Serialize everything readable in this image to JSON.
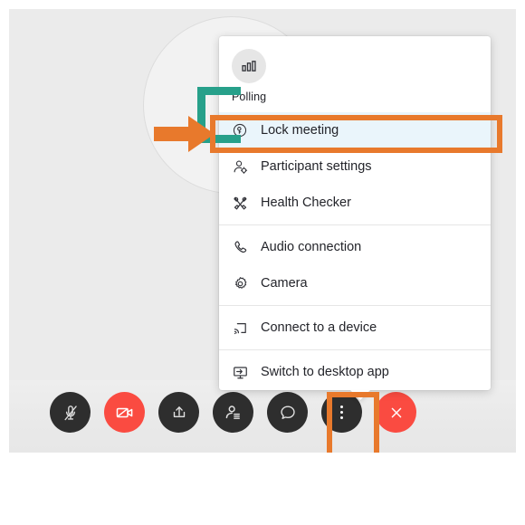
{
  "app": {
    "kind": "video-meeting-controls",
    "accent_orange": "#e8792c",
    "accent_teal": "#27a08a",
    "highlight_blue": "#eaf5fb",
    "button_dark": "#2e2e2e",
    "button_red": "#fa4b41",
    "stage_bg": "#ebebeb"
  },
  "menu": {
    "header": {
      "icon": "polling-bar-chart-icon",
      "label": "Polling"
    },
    "items": [
      {
        "label": "Lock meeting",
        "icon": "lock-key-icon",
        "highlighted": true,
        "divider_after": false
      },
      {
        "label": "Participant settings",
        "icon": "participant-gear-icon",
        "highlighted": false,
        "divider_after": false
      },
      {
        "label": "Health Checker",
        "icon": "health-checker-icon",
        "highlighted": false,
        "divider_after": true
      },
      {
        "label": "Audio connection",
        "icon": "phone-icon",
        "highlighted": false,
        "divider_after": false
      },
      {
        "label": "Camera",
        "icon": "gear-icon",
        "highlighted": false,
        "divider_after": true
      },
      {
        "label": "Connect to a device",
        "icon": "cast-device-icon",
        "highlighted": false,
        "divider_after": true
      },
      {
        "label": "Switch to desktop app",
        "icon": "desktop-monitor-icon",
        "highlighted": false,
        "divider_after": false
      }
    ]
  },
  "controls": [
    {
      "name": "mute-button",
      "icon": "microphone-muted-icon",
      "style": "dark",
      "state": "muted"
    },
    {
      "name": "video-button",
      "icon": "camera-off-icon",
      "style": "red",
      "state": "off"
    },
    {
      "name": "share-content-button",
      "icon": "share-upload-icon",
      "style": "dark",
      "state": "idle"
    },
    {
      "name": "participants-button",
      "icon": "participants-list-icon",
      "style": "dark",
      "state": "idle"
    },
    {
      "name": "chat-button",
      "icon": "chat-bubble-icon",
      "style": "dark",
      "state": "idle"
    },
    {
      "name": "more-options-button",
      "icon": "more-vertical-dots-icon",
      "style": "dark",
      "state": "active"
    },
    {
      "name": "leave-meeting-button",
      "icon": "close-x-icon",
      "style": "red",
      "state": "idle"
    }
  ],
  "annotations": {
    "orange_box_menu_item": "Lock meeting",
    "orange_box_control": "more-options-button",
    "arrow_right": "points-to-lock-meeting",
    "arrow_up": "points-to-more-options-button",
    "teal_bracket": "bracket-left-of-lock-meeting"
  }
}
